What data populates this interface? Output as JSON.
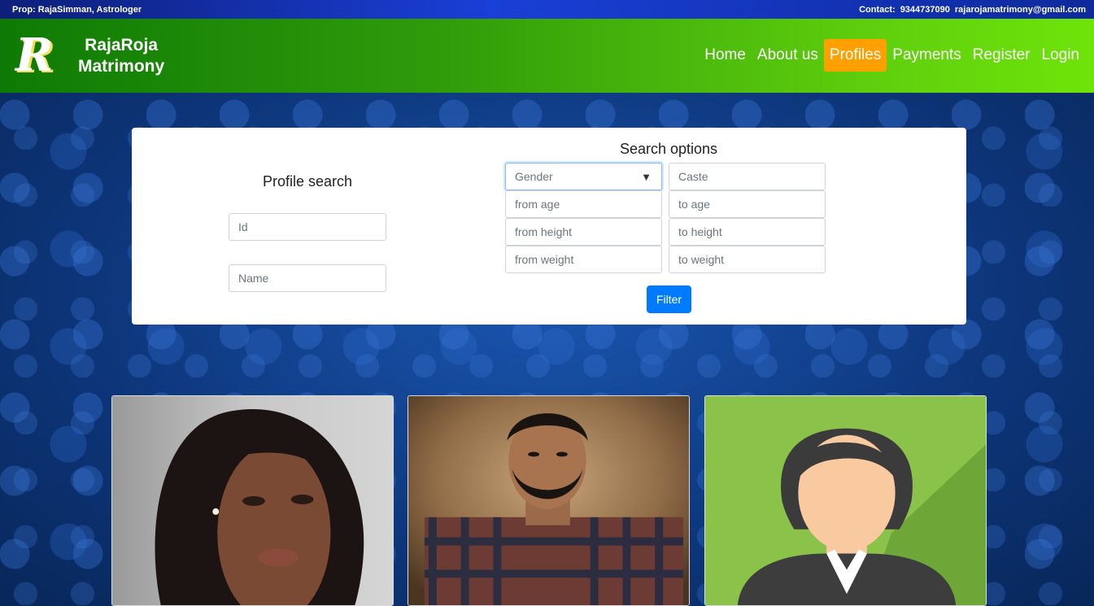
{
  "topbar": {
    "prop": "Prop: RajaSimman, Astrologer",
    "contact_label": "Contact:",
    "phone": "9344737090",
    "email": "rajarojamatrimony@gmail.com"
  },
  "brand": {
    "logo_letter": "R",
    "line1": "RajaRoja",
    "line2": "Matrimony"
  },
  "nav": {
    "items": [
      "Home",
      "About us",
      "Profiles",
      "Payments",
      "Register",
      "Login"
    ],
    "active": "Profiles"
  },
  "profile_search": {
    "title": "Profile search",
    "id_placeholder": "Id",
    "name_placeholder": "Name"
  },
  "search_options": {
    "title": "Search options",
    "gender_selected": "Gender",
    "caste_placeholder": "Caste",
    "from_age_placeholder": "from age",
    "to_age_placeholder": "to age",
    "from_height_placeholder": "from height",
    "to_height_placeholder": "to height",
    "from_weight_placeholder": "from weight",
    "to_weight_placeholder": "to weight",
    "filter_label": "Filter"
  },
  "colors": {
    "accent_active": "#ffa000",
    "filter_button": "#007bff",
    "nav_green_start": "#0e7a05",
    "nav_green_end": "#6ee40a"
  },
  "icons": [
    "chevron-down-icon"
  ]
}
